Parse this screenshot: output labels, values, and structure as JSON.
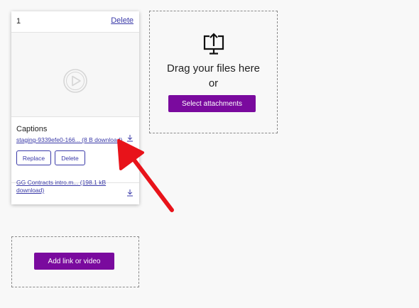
{
  "card": {
    "index": "1",
    "delete_label": "Delete",
    "captions_title": "Captions",
    "caption_file": {
      "name": "staging-9339efe0-166... (8 B download)",
      "replace_label": "Replace",
      "delete_label": "Delete"
    },
    "attachment_file": {
      "line1": "GG Contracts intro.m... (198.1 kB",
      "line2": "download)"
    }
  },
  "dropzone": {
    "line1": "Drag your files here",
    "line2": "or",
    "button_label": "Select attachments"
  },
  "link_zone": {
    "button_label": "Add link or video"
  },
  "icons": {
    "video": "play-circle-icon",
    "upload": "monitor-upload-icon",
    "download": "download-icon"
  },
  "colors": {
    "accent": "#7a0a9e",
    "link": "#3a3aa8",
    "annotation": "#e8131a"
  }
}
